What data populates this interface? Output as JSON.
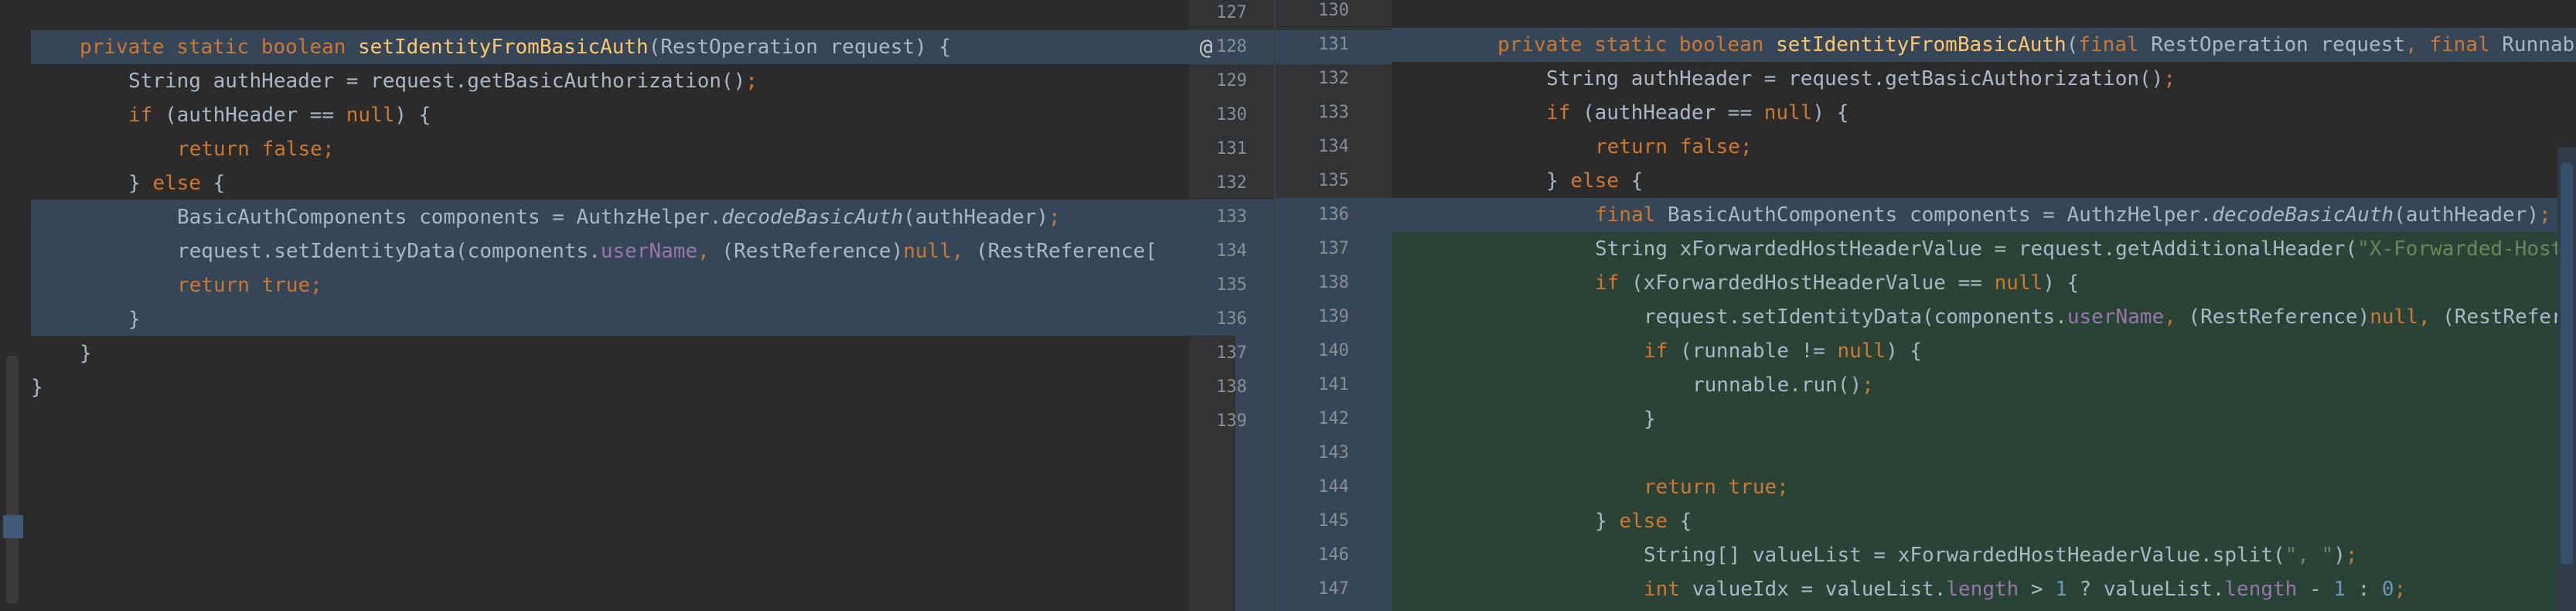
{
  "left": {
    "lines": [
      {
        "indent": 1,
        "tokens": [
          {
            "t": "private static boolean ",
            "c": "kw"
          },
          {
            "t": "setIdentityFromBasicAuth",
            "c": "fn"
          },
          {
            "t": "(RestOperation request) {",
            "c": ""
          }
        ]
      },
      {
        "indent": 2,
        "tokens": [
          {
            "t": "String authHeader = request.getBasicAuthorization()",
            "c": ""
          },
          {
            "t": ";",
            "c": "kw"
          }
        ]
      },
      {
        "indent": 2,
        "tokens": [
          {
            "t": "if ",
            "c": "kw"
          },
          {
            "t": "(authHeader == ",
            "c": ""
          },
          {
            "t": "null",
            "c": "kw"
          },
          {
            "t": ") {",
            "c": ""
          }
        ]
      },
      {
        "indent": 3,
        "tokens": [
          {
            "t": "return false;",
            "c": "kw"
          }
        ]
      },
      {
        "indent": 2,
        "tokens": [
          {
            "t": "} ",
            "c": ""
          },
          {
            "t": "else ",
            "c": "kw"
          },
          {
            "t": "{",
            "c": ""
          }
        ]
      },
      {
        "indent": 3,
        "tokens": [
          {
            "t": "BasicAuthComponents components = AuthzHelper.",
            "c": ""
          },
          {
            "t": "decodeBasicAuth",
            "c": "it"
          },
          {
            "t": "(authHeader)",
            "c": ""
          },
          {
            "t": ";",
            "c": "kw"
          }
        ]
      },
      {
        "indent": 3,
        "tokens": [
          {
            "t": "request.setIdentityData(components.",
            "c": ""
          },
          {
            "t": "userName",
            "c": "fld"
          },
          {
            "t": ", ",
            "c": "kw"
          },
          {
            "t": "(RestReference)",
            "c": ""
          },
          {
            "t": "null, ",
            "c": "kw"
          },
          {
            "t": "(RestReference[",
            "c": ""
          }
        ]
      },
      {
        "indent": 3,
        "tokens": [
          {
            "t": "return true;",
            "c": "kw"
          }
        ]
      },
      {
        "indent": 2,
        "tokens": [
          {
            "t": "}",
            "c": ""
          }
        ]
      },
      {
        "indent": 1,
        "tokens": [
          {
            "t": "}",
            "c": ""
          }
        ]
      },
      {
        "indent": 0,
        "tokens": [
          {
            "t": "}",
            "c": ""
          }
        ]
      }
    ]
  },
  "gutter": {
    "left_numbers": [
      "127",
      "128",
      "129",
      "130",
      "131",
      "132",
      "133",
      "134",
      "135",
      "136",
      "137",
      "138",
      "139"
    ],
    "right_numbers": [
      "130",
      "131",
      "132",
      "133",
      "134",
      "135",
      "136",
      "137",
      "138",
      "139",
      "140",
      "141",
      "142",
      "143",
      "144",
      "145",
      "146",
      "147"
    ],
    "at_symbol": "@"
  },
  "right": {
    "lines": [
      {
        "indent": 1,
        "tokens": [
          {
            "t": "private static boolean ",
            "c": "kw"
          },
          {
            "t": "setIdentityFromBasicAuth",
            "c": "fn"
          },
          {
            "t": "(",
            "c": ""
          },
          {
            "t": "final ",
            "c": "kw"
          },
          {
            "t": "RestOperation request",
            "c": ""
          },
          {
            "t": ", final ",
            "c": "kw"
          },
          {
            "t": "Runnable",
            "c": ""
          }
        ]
      },
      {
        "indent": 2,
        "tokens": [
          {
            "t": "String authHeader = request.getBasicAuthorization()",
            "c": ""
          },
          {
            "t": ";",
            "c": "kw"
          }
        ]
      },
      {
        "indent": 2,
        "tokens": [
          {
            "t": "if ",
            "c": "kw"
          },
          {
            "t": "(authHeader == ",
            "c": ""
          },
          {
            "t": "null",
            "c": "kw"
          },
          {
            "t": ") {",
            "c": ""
          }
        ]
      },
      {
        "indent": 3,
        "tokens": [
          {
            "t": "return false;",
            "c": "kw"
          }
        ]
      },
      {
        "indent": 2,
        "tokens": [
          {
            "t": "} ",
            "c": ""
          },
          {
            "t": "else ",
            "c": "kw"
          },
          {
            "t": "{",
            "c": ""
          }
        ]
      },
      {
        "indent": 3,
        "tokens": [
          {
            "t": "final ",
            "c": "kw"
          },
          {
            "t": "BasicAuthComponents components = AuthzHelper.",
            "c": ""
          },
          {
            "t": "decodeBasicAuth",
            "c": "it"
          },
          {
            "t": "(authHeader)",
            "c": ""
          },
          {
            "t": ";",
            "c": "kw"
          }
        ]
      },
      {
        "indent": 3,
        "tokens": [
          {
            "t": "String xForwardedHostHeaderValue = request.getAdditionalHeader(",
            "c": ""
          },
          {
            "t": "\"X-Forwarded-Host\"",
            "c": "str"
          },
          {
            "t": ")",
            "c": ""
          }
        ]
      },
      {
        "indent": 3,
        "tokens": [
          {
            "t": "if ",
            "c": "kw"
          },
          {
            "t": "(xForwardedHostHeaderValue == ",
            "c": ""
          },
          {
            "t": "null",
            "c": "kw"
          },
          {
            "t": ") {",
            "c": ""
          }
        ]
      },
      {
        "indent": 4,
        "tokens": [
          {
            "t": "request.setIdentityData(components.",
            "c": ""
          },
          {
            "t": "userName",
            "c": "fld"
          },
          {
            "t": ", ",
            "c": "kw"
          },
          {
            "t": "(RestReference)",
            "c": ""
          },
          {
            "t": "null, ",
            "c": "kw"
          },
          {
            "t": "(RestReferen",
            "c": ""
          }
        ]
      },
      {
        "indent": 4,
        "tokens": [
          {
            "t": "if ",
            "c": "kw"
          },
          {
            "t": "(runnable != ",
            "c": ""
          },
          {
            "t": "null",
            "c": "kw"
          },
          {
            "t": ") {",
            "c": ""
          }
        ]
      },
      {
        "indent": 5,
        "tokens": [
          {
            "t": "runnable.run()",
            "c": ""
          },
          {
            "t": ";",
            "c": "kw"
          }
        ]
      },
      {
        "indent": 4,
        "tokens": [
          {
            "t": "}",
            "c": ""
          }
        ]
      },
      {
        "indent": 0,
        "tokens": []
      },
      {
        "indent": 4,
        "tokens": [
          {
            "t": "return true;",
            "c": "kw"
          }
        ]
      },
      {
        "indent": 3,
        "tokens": [
          {
            "t": "} ",
            "c": ""
          },
          {
            "t": "else ",
            "c": "kw"
          },
          {
            "t": "{",
            "c": ""
          }
        ]
      },
      {
        "indent": 4,
        "tokens": [
          {
            "t": "String[] valueList = xForwardedHostHeaderValue.split(",
            "c": ""
          },
          {
            "t": "\", \"",
            "c": "str"
          },
          {
            "t": ")",
            "c": ""
          },
          {
            "t": ";",
            "c": "kw"
          }
        ]
      },
      {
        "indent": 4,
        "tokens": [
          {
            "t": "int ",
            "c": "kw"
          },
          {
            "t": "valueIdx = valueList.",
            "c": ""
          },
          {
            "t": "length",
            "c": "fld"
          },
          {
            "t": " > ",
            "c": ""
          },
          {
            "t": "1",
            "c": "num"
          },
          {
            "t": " ? valueList.",
            "c": ""
          },
          {
            "t": "length",
            "c": "fld"
          },
          {
            "t": " - ",
            "c": ""
          },
          {
            "t": "1",
            "c": "num"
          },
          {
            "t": " : ",
            "c": ""
          },
          {
            "t": "0",
            "c": "num"
          },
          {
            "t": ";",
            "c": "kw"
          }
        ]
      }
    ]
  }
}
